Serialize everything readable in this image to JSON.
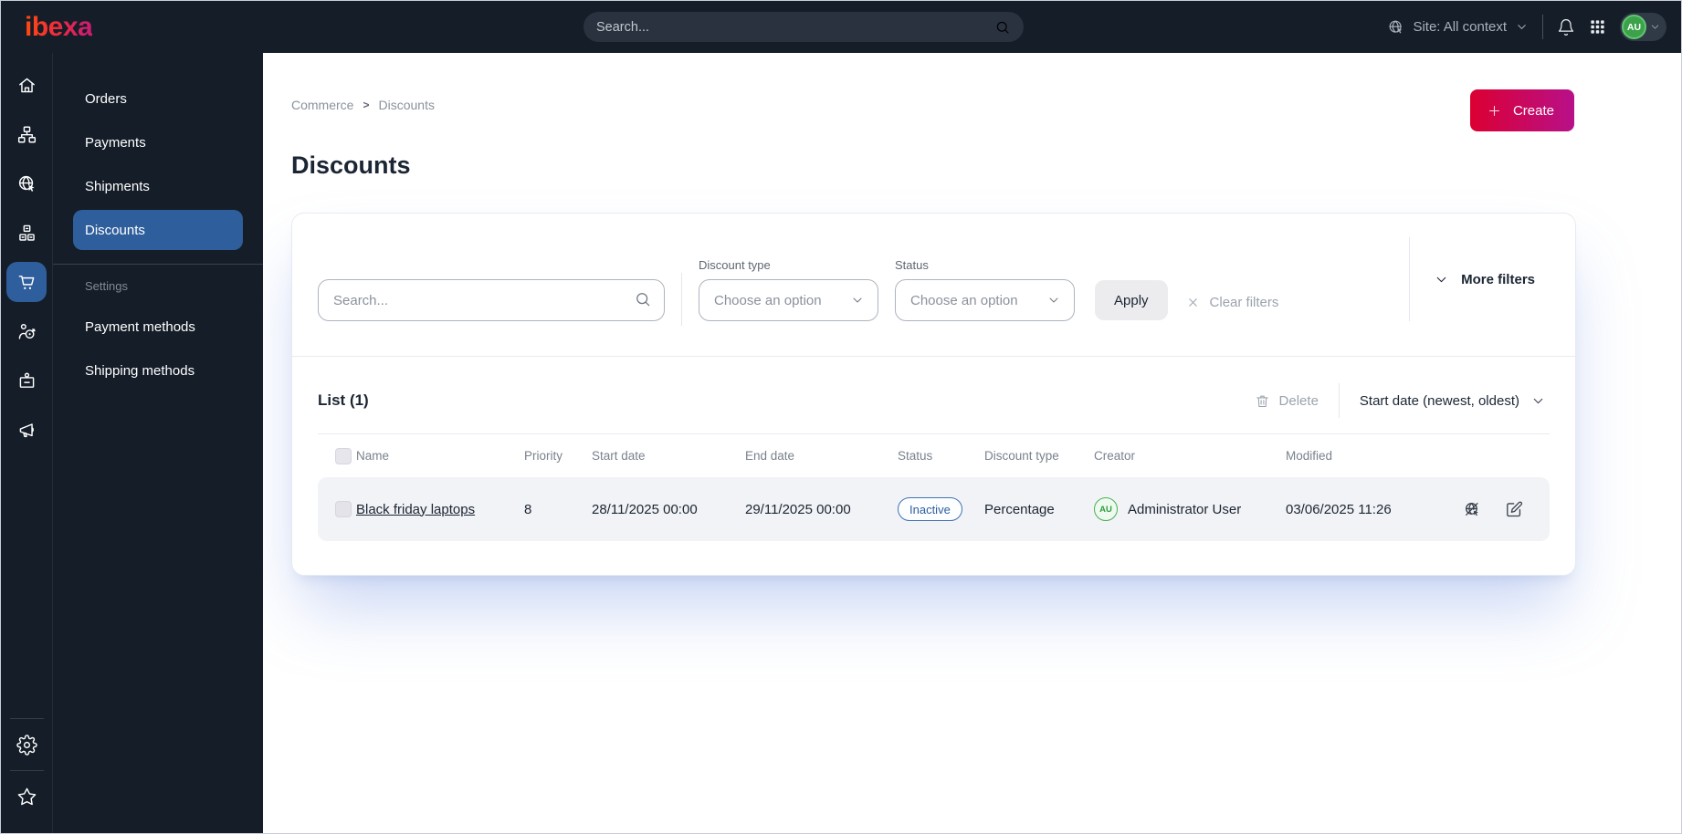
{
  "topbar": {
    "logo_text": "ibexa",
    "search_placeholder": "Search...",
    "site_context_label": "Site: All context",
    "user_initials": "AU"
  },
  "sidebar": {
    "icon_names": [
      "home-icon",
      "content-tree-icon",
      "site-globe-icon",
      "products-icon",
      "commerce-cart-icon",
      "personalization-icon",
      "jobs-badge-icon",
      "marketing-megaphone-icon"
    ],
    "active_icon": "commerce-cart-icon",
    "bottom_icon_names": [
      "settings-gear-icon",
      "bookmarks-star-icon"
    ]
  },
  "menu": {
    "items": [
      "Orders",
      "Payments",
      "Shipments",
      "Discounts"
    ],
    "active_item": "Discounts",
    "section_label": "Settings",
    "section_items": [
      "Payment methods",
      "Shipping methods"
    ]
  },
  "breadcrumb": {
    "items": [
      "Commerce",
      "Discounts"
    ],
    "separator": ">"
  },
  "page": {
    "title": "Discounts",
    "create_label": "Create"
  },
  "filters": {
    "search_placeholder": "Search...",
    "discount_type_label": "Discount type",
    "discount_type_value": "Choose an option",
    "status_label": "Status",
    "status_value": "Choose an option",
    "apply_label": "Apply",
    "clear_label": "Clear filters",
    "more_filters_label": "More filters"
  },
  "list": {
    "title": "List (1)",
    "delete_label": "Delete",
    "sort_label": "Start date (newest, oldest)",
    "columns": [
      "Name",
      "Priority",
      "Start date",
      "End date",
      "Status",
      "Discount type",
      "Creator",
      "Modified"
    ],
    "rows": [
      {
        "name": "Black friday laptops",
        "priority": "8",
        "start_date": "28/11/2025 00:00",
        "end_date": "29/11/2025 00:00",
        "status": "Inactive",
        "discount_type": "Percentage",
        "creator_initials": "AU",
        "creator_name": "Administrator User",
        "modified": "03/06/2025 11:26"
      }
    ]
  },
  "colors": {
    "topbar_bg": "#141d28",
    "brand_gradient_start": "#ff4713",
    "brand_gradient_end": "#cf1d6e",
    "create_gradient_start": "#db0032",
    "create_gradient_end": "#b81089",
    "active_item_bg": "#2f5e9c",
    "status_inactive_blue": "#2e5f9e",
    "creator_green": "#3fa74c"
  }
}
